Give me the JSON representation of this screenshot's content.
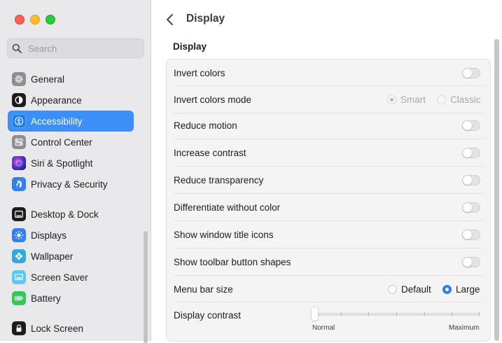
{
  "search": {
    "placeholder": "Search"
  },
  "sidebar": {
    "items": [
      {
        "label": "General",
        "icon": "gear-icon",
        "color": "#8e8e93"
      },
      {
        "label": "Appearance",
        "icon": "appearance-icon",
        "color": "#1d1d1f"
      },
      {
        "label": "Accessibility",
        "icon": "accessibility-icon",
        "color": "#1e7cf2",
        "active": true
      },
      {
        "label": "Control Center",
        "icon": "control-center-icon",
        "color": "#8e8e93"
      },
      {
        "label": "Siri & Spotlight",
        "icon": "siri-icon",
        "color": "#6b3fc9"
      },
      {
        "label": "Privacy & Security",
        "icon": "hand-icon",
        "color": "#2f7ff6"
      },
      {
        "label": "Desktop & Dock",
        "icon": "dock-icon",
        "color": "#1d1d1f"
      },
      {
        "label": "Displays",
        "icon": "sun-icon",
        "color": "#2f7ff6"
      },
      {
        "label": "Wallpaper",
        "icon": "wallpaper-icon",
        "color": "#34aadc"
      },
      {
        "label": "Screen Saver",
        "icon": "screensaver-icon",
        "color": "#5ac8fa"
      },
      {
        "label": "Battery",
        "icon": "battery-icon",
        "color": "#34c759"
      },
      {
        "label": "Lock Screen",
        "icon": "lock-icon",
        "color": "#1d1d1f"
      }
    ]
  },
  "header": {
    "title": "Display"
  },
  "section": {
    "title": "Display"
  },
  "settings": {
    "invert_colors": {
      "label": "Invert colors",
      "on": false
    },
    "invert_colors_mode": {
      "label": "Invert colors mode",
      "options": [
        "Smart",
        "Classic"
      ],
      "selected": "Smart"
    },
    "reduce_motion": {
      "label": "Reduce motion",
      "on": false
    },
    "increase_contrast": {
      "label": "Increase contrast",
      "on": false
    },
    "reduce_transparency": {
      "label": "Reduce transparency",
      "on": false
    },
    "differentiate_without_color": {
      "label": "Differentiate without color",
      "on": false
    },
    "show_window_title_icons": {
      "label": "Show window title icons",
      "on": false
    },
    "show_toolbar_button_shapes": {
      "label": "Show toolbar button shapes",
      "on": false
    },
    "menu_bar_size": {
      "label": "Menu bar size",
      "options": [
        "Default",
        "Large"
      ],
      "selected": "Large"
    },
    "display_contrast": {
      "label": "Display contrast",
      "min_label": "Normal",
      "max_label": "Maximum",
      "value": 0
    }
  },
  "colors": {
    "accent": "#2f7ff6",
    "sidebar_selection": "#3b8ff6"
  }
}
